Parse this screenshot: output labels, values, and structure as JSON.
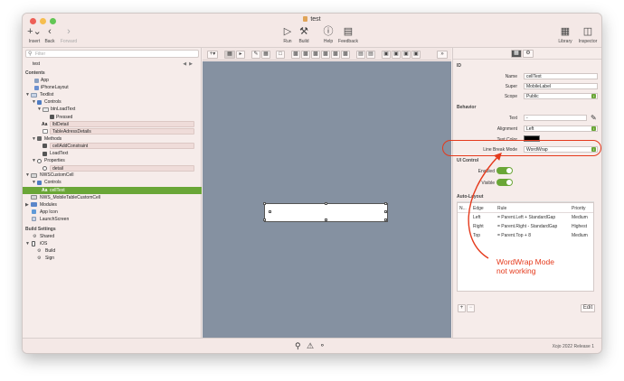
{
  "window": {
    "title": "test",
    "title_icon": "xojo-project-icon"
  },
  "toolbar": {
    "insert": "Insert",
    "back": "Back",
    "forward": "Forward",
    "run": "Run",
    "build": "Build",
    "help": "Help",
    "feedback": "Feedback",
    "library": "Library",
    "inspector": "Inspector"
  },
  "navigator": {
    "filter_placeholder": "Filter",
    "path": "test",
    "contents_header": "Contents",
    "build_settings_header": "Build Settings",
    "items": [
      {
        "label": "App",
        "icon": "app-icon"
      },
      {
        "label": "iPhoneLayout",
        "icon": "layout-icon"
      },
      {
        "label": "Textlist",
        "icon": "screen-icon"
      },
      {
        "label": "Controls",
        "icon": "controls-icon"
      },
      {
        "label": "btnLoadText",
        "icon": "button-icon"
      },
      {
        "label": "Pressed",
        "icon": "event-icon"
      },
      {
        "label": "lblDetail",
        "icon": "label-icon"
      },
      {
        "label": "TableAdressDetails",
        "icon": "table-icon"
      },
      {
        "label": "Methods",
        "icon": "methods-icon"
      },
      {
        "label": "cellAddConstraint",
        "icon": "method-icon"
      },
      {
        "label": "LoadText",
        "icon": "method-icon"
      },
      {
        "label": "Properties",
        "icon": "properties-icon"
      },
      {
        "label": "detail",
        "icon": "property-icon"
      },
      {
        "label": "NWSCustomCell",
        "icon": "class-icon"
      },
      {
        "label": "Controls",
        "icon": "controls-icon"
      },
      {
        "label": "cellText",
        "icon": "label-icon"
      },
      {
        "label": "NWS_MobileTableCustomCell",
        "icon": "class-icon"
      },
      {
        "label": "Modules",
        "icon": "folder-icon"
      },
      {
        "label": "App Icon",
        "icon": "image-icon"
      },
      {
        "label": "LaunchScreen",
        "icon": "screen-icon"
      }
    ],
    "build_items": [
      {
        "label": "Shared",
        "icon": "gear-icon"
      },
      {
        "label": "iOS",
        "icon": "ios-icon"
      },
      {
        "label": "Build",
        "icon": "build-icon"
      },
      {
        "label": "Sign",
        "icon": "sign-icon"
      }
    ]
  },
  "inspector": {
    "id_header": "ID",
    "name_label": "Name",
    "name_value": "cellText",
    "super_label": "Super",
    "super_value": "MobileLabel",
    "scope_label": "Scope",
    "scope_value": "Public",
    "behavior_header": "Behavior",
    "text_label": "Text",
    "text_value": "-",
    "alignment_label": "Alignment",
    "alignment_value": "Left",
    "textcolor_label": "Text Color",
    "textcolor_value": "#000000",
    "linebreak_label": "Line Break Mode",
    "linebreak_value": "WordWrap",
    "uicontrol_header": "UI Control",
    "enabled_label": "Enabled",
    "visible_label": "Visible",
    "autolayout_header": "Auto-Layout",
    "autolayout_columns": [
      "N...",
      "Edge",
      "Rule",
      "Priority"
    ],
    "autolayout_rows": [
      {
        "edge": "Left",
        "rule": "= Parent.Left + StandardGap",
        "priority": "Medium"
      },
      {
        "edge": "Right",
        "rule": "= Parent.Right - StandardGap",
        "priority": "Highest"
      },
      {
        "edge": "Top",
        "rule": "= Parent.Top + 8",
        "priority": "Medium"
      }
    ],
    "add_label": "+",
    "remove_label": "−",
    "edit_label": "Edit"
  },
  "annotation": {
    "line1": "WordWrap Mode",
    "line2": "not working"
  },
  "status": {
    "version": "Xojo 2022 Release 1"
  },
  "colors": {
    "accent": "#6aa637",
    "annotation": "#e53a1c",
    "canvas": "#8591a1"
  }
}
